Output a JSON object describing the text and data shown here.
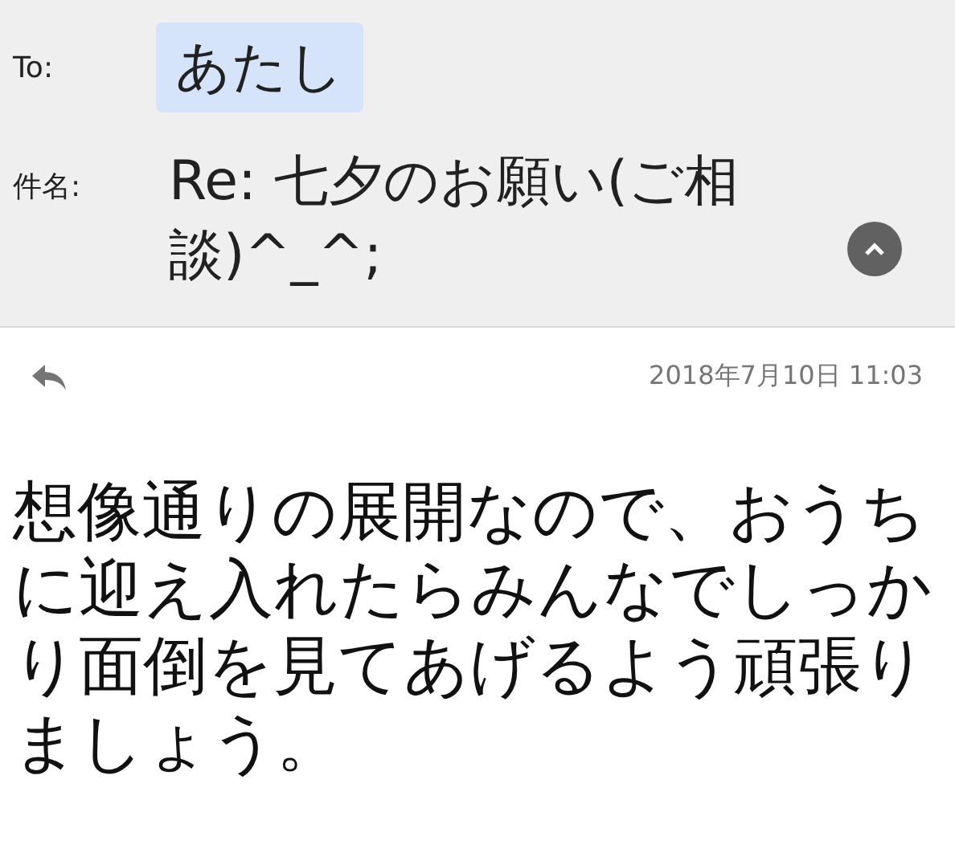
{
  "header": {
    "to_label": "To:",
    "recipient": "あたし",
    "subject_label": "件名:",
    "subject": "Re: 七夕のお願い(ご相談)^_^;"
  },
  "message": {
    "date": "2018年7月10日 11:03",
    "body": "想像通りの展開なので、おうちに迎え入れたらみんなでしっかり面倒を見てあげるよう頑張りましょう。"
  }
}
